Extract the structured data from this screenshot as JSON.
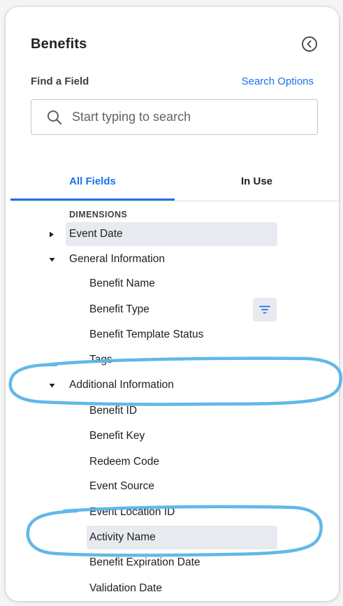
{
  "panel": {
    "title": "Benefits",
    "collapse_icon": "chevron-left-circle-icon"
  },
  "search": {
    "label": "Find a Field",
    "options_link": "Search Options",
    "placeholder": "Start typing to search",
    "value": "",
    "icon": "search-icon"
  },
  "tabs": [
    {
      "label": "All Fields",
      "active": true
    },
    {
      "label": "In Use",
      "active": false
    }
  ],
  "fields": {
    "section_label": "DIMENSIONS",
    "items": [
      {
        "label": "Event Date",
        "kind": "group",
        "expanded": false,
        "selected": true
      },
      {
        "label": "General Information",
        "kind": "group",
        "expanded": true,
        "selected": false
      },
      {
        "label": "Benefit Name",
        "kind": "field",
        "selected": false
      },
      {
        "label": "Benefit Type",
        "kind": "field",
        "selected": false,
        "filter_icon": "filter-icon"
      },
      {
        "label": "Benefit Template Status",
        "kind": "field",
        "selected": false
      },
      {
        "label": "Tags",
        "kind": "field",
        "selected": false
      },
      {
        "label": "Additional Information",
        "kind": "group",
        "expanded": true,
        "selected": false
      },
      {
        "label": "Benefit ID",
        "kind": "field",
        "selected": false
      },
      {
        "label": "Benefit Key",
        "kind": "field",
        "selected": false
      },
      {
        "label": "Redeem Code",
        "kind": "field",
        "selected": false
      },
      {
        "label": "Event Source",
        "kind": "field",
        "selected": false
      },
      {
        "label": "Event Location ID",
        "kind": "field",
        "selected": false
      },
      {
        "label": "Activity Name",
        "kind": "field",
        "selected": true
      },
      {
        "label": "Benefit Expiration Date",
        "kind": "field",
        "selected": false
      },
      {
        "label": "Validation Date",
        "kind": "field",
        "selected": false
      }
    ]
  },
  "colors": {
    "accent": "#1a73e8",
    "highlight_stroke": "#5ab4e8",
    "selected_bg": "#e8eaf0"
  }
}
